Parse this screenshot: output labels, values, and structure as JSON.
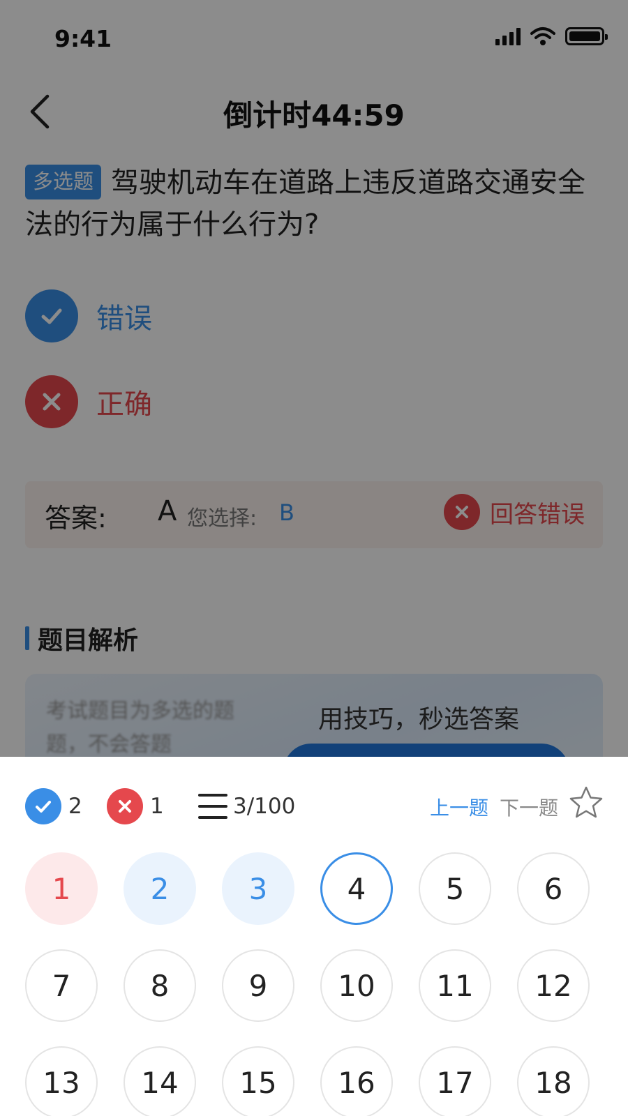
{
  "status_bar": {
    "time": "9:41"
  },
  "nav": {
    "title": "倒计时44:59"
  },
  "question": {
    "tag": "多选题",
    "text": "驾驶机动车在道路上违反道路交通安全法的行为属于什么行为?"
  },
  "options": [
    {
      "label": "错误",
      "state": "correct"
    },
    {
      "label": "正确",
      "state": "wrong"
    }
  ],
  "answer": {
    "label": "答案:",
    "value": "A",
    "selected_label": "您选择:",
    "selected_value": "B",
    "result_text": "回答错误"
  },
  "analysis": {
    "title": "题目解析",
    "text_blurred": "考试题目为多选的题题，不会答题",
    "tip": "用技巧，秒选答案"
  },
  "sheet": {
    "correct_count": "2",
    "wrong_count": "1",
    "progress": "3/100",
    "prev_label": "上一题",
    "next_label": "下一题",
    "questions": [
      {
        "n": "1",
        "state": "wrong"
      },
      {
        "n": "2",
        "state": "right"
      },
      {
        "n": "3",
        "state": "right"
      },
      {
        "n": "4",
        "state": "current"
      },
      {
        "n": "5",
        "state": "none"
      },
      {
        "n": "6",
        "state": "none"
      },
      {
        "n": "7",
        "state": "none"
      },
      {
        "n": "8",
        "state": "none"
      },
      {
        "n": "9",
        "state": "none"
      },
      {
        "n": "10",
        "state": "none"
      },
      {
        "n": "11",
        "state": "none"
      },
      {
        "n": "12",
        "state": "none"
      },
      {
        "n": "13",
        "state": "none"
      },
      {
        "n": "14",
        "state": "none"
      },
      {
        "n": "15",
        "state": "none"
      },
      {
        "n": "16",
        "state": "none"
      },
      {
        "n": "17",
        "state": "none"
      },
      {
        "n": "18",
        "state": "none"
      }
    ]
  },
  "colors": {
    "accent_blue": "#3a8ee6",
    "error_red": "#e5484d"
  },
  "icons": [
    "chevron-left-icon",
    "check-icon",
    "close-icon",
    "menu-icon",
    "star-icon",
    "signal-icon",
    "wifi-icon",
    "battery-icon"
  ]
}
